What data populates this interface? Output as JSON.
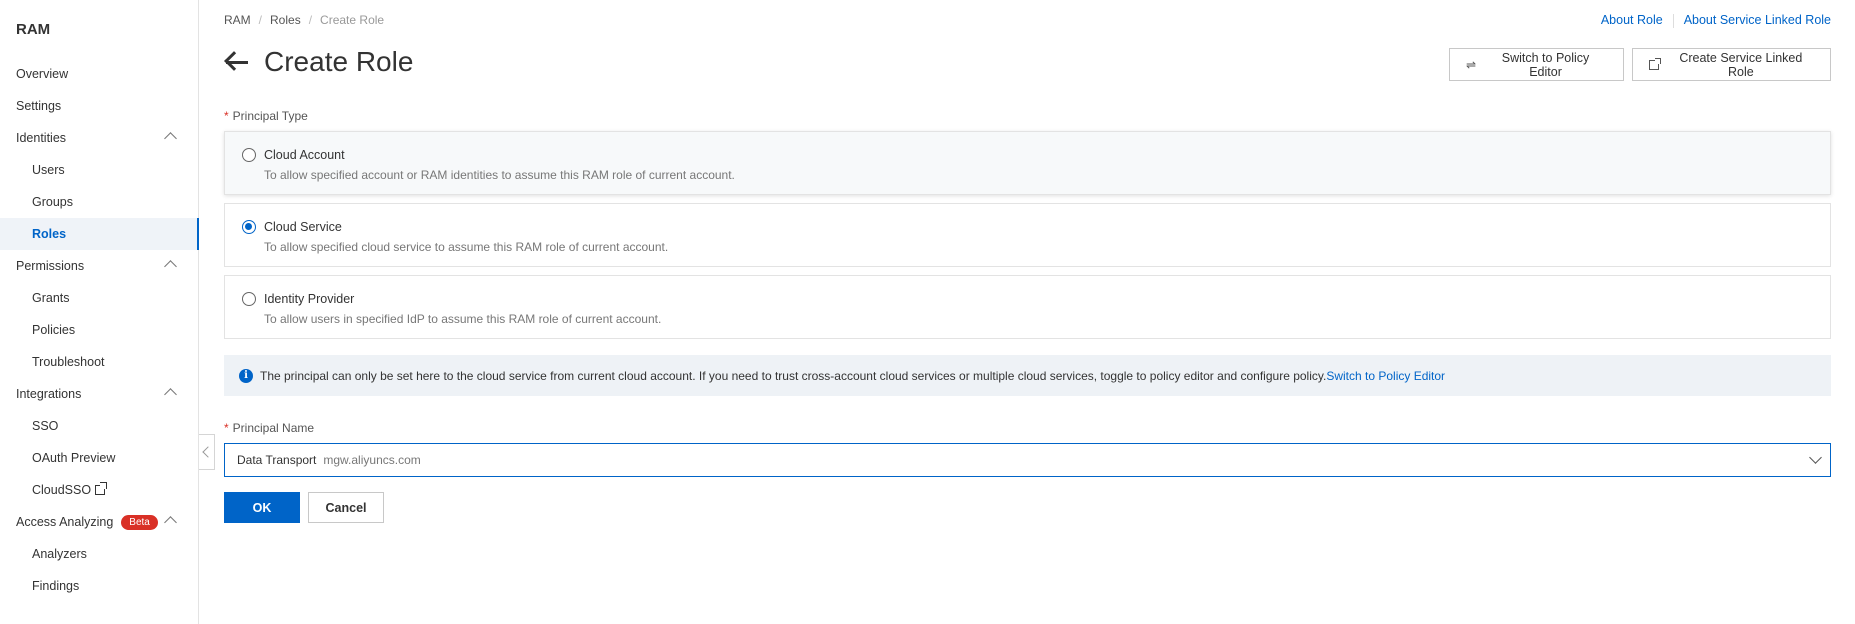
{
  "sidebar": {
    "brand": "RAM",
    "items": [
      {
        "label": "Overview"
      },
      {
        "label": "Settings"
      },
      {
        "label": "Identities"
      },
      {
        "label": "Users"
      },
      {
        "label": "Groups"
      },
      {
        "label": "Roles"
      },
      {
        "label": "Permissions"
      },
      {
        "label": "Grants"
      },
      {
        "label": "Policies"
      },
      {
        "label": "Troubleshoot"
      },
      {
        "label": "Integrations"
      },
      {
        "label": "SSO"
      },
      {
        "label": "OAuth Preview"
      },
      {
        "label": "CloudSSO"
      },
      {
        "label": "Access Analyzing",
        "badge": "Beta"
      },
      {
        "label": "Analyzers"
      },
      {
        "label": "Findings"
      }
    ]
  },
  "breadcrumb": {
    "items": [
      "RAM",
      "Roles",
      "Create Role"
    ],
    "separator": "/"
  },
  "top_links": {
    "about_role": "About Role",
    "about_slr": "About Service Linked Role"
  },
  "header": {
    "title": "Create Role",
    "switch_editor": "Switch to Policy Editor",
    "create_slr": "Create Service Linked Role"
  },
  "form": {
    "required_mark": "*",
    "principal_type_label": "Principal Type",
    "options": [
      {
        "title": "Cloud Account",
        "desc": "To allow specified account or RAM identities to assume this RAM role of current account.",
        "checked": false
      },
      {
        "title": "Cloud Service",
        "desc": "To allow specified cloud service to assume this RAM role of current account.",
        "checked": true
      },
      {
        "title": "Identity Provider",
        "desc": "To allow users in specified IdP to assume this RAM role of current account.",
        "checked": false
      }
    ],
    "info": {
      "icon": "i",
      "text": "The principal can only be set here to the cloud service from current cloud account. If you need to trust cross-account cloud services or multiple cloud services, toggle to policy editor and configure policy.",
      "link": "Switch to Policy Editor"
    },
    "principal_name_label": "Principal Name",
    "principal_name_value": "Data Transport",
    "principal_name_host": "mgw.aliyuncs.com",
    "ok": "OK",
    "cancel": "Cancel"
  },
  "colors": {
    "accent": "#0064c8",
    "danger": "#d93026",
    "info_bg": "#eef2f6"
  }
}
